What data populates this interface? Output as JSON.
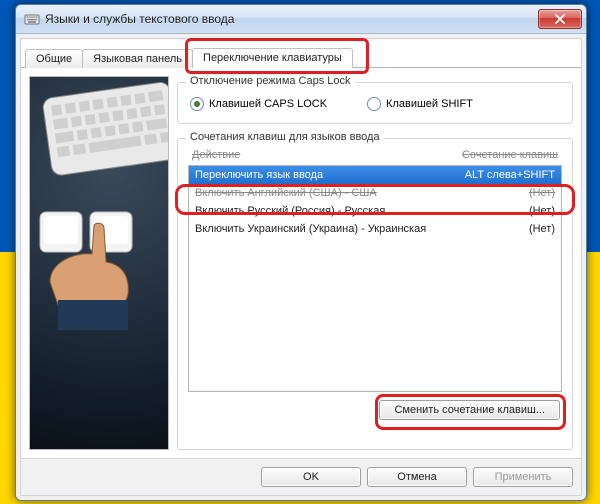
{
  "window": {
    "title": "Языки и службы текстового ввода"
  },
  "tabs": {
    "general": "Общие",
    "langbar": "Языковая панель",
    "switch": "Переключение клавиатуры"
  },
  "capslock_group": {
    "legend": "Отключение режима Caps Lock",
    "option_caps": "Клавишей CAPS LOCK",
    "option_shift": "Клавишей SHIFT"
  },
  "hotkeys_group": {
    "legend": "Сочетания клавиш для языков ввода",
    "header_action": "Действие",
    "header_hotkey": "Сочетание клавиш",
    "rows": [
      {
        "action": "Переключить язык ввода",
        "hotkey": "ALT слева+SHIFT",
        "selected": true
      },
      {
        "action": "Включить Английский (США) - США",
        "hotkey": "(Нет)",
        "strike": true
      },
      {
        "action": "Включить Русский (Россия) - Русская",
        "hotkey": "(Нет)"
      },
      {
        "action": "Включить Украинский (Украина) - Украинская",
        "hotkey": "(Нет)"
      }
    ],
    "change_button": "Сменить сочетание клавиш..."
  },
  "buttons": {
    "ok": "OK",
    "cancel": "Отмена",
    "apply": "Применить"
  }
}
